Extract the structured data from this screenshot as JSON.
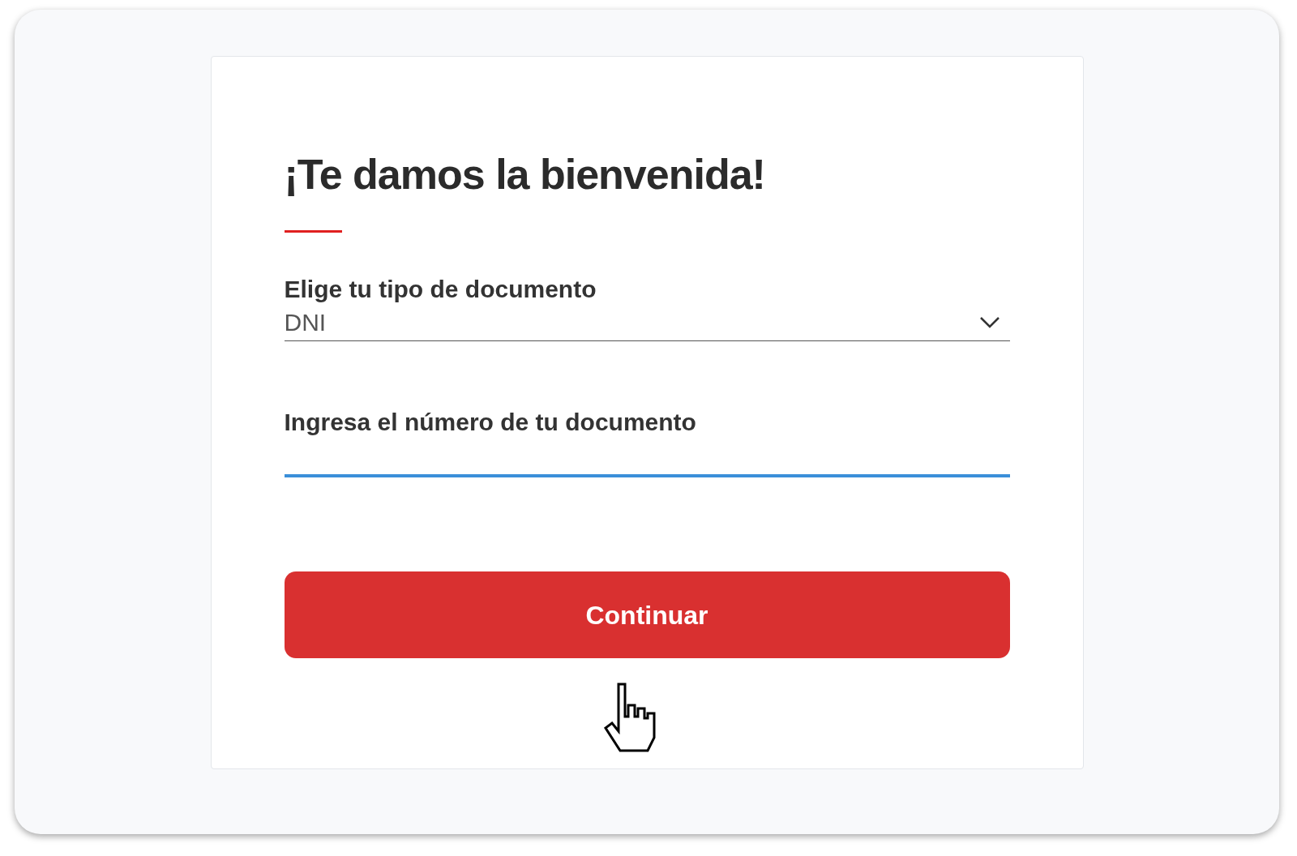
{
  "heading": "¡Te damos la bienvenida!",
  "document_type": {
    "label": "Elige tu tipo de documento",
    "value": "DNI"
  },
  "document_number": {
    "label": "Ingresa el número de tu documento",
    "focused": true
  },
  "button": {
    "label": "Continuar"
  }
}
